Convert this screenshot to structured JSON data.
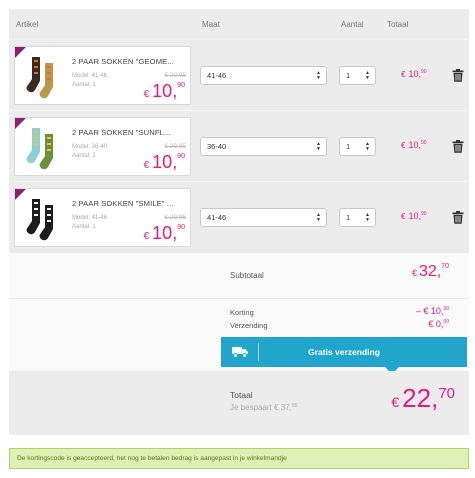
{
  "headers": {
    "article": "Artikel",
    "size": "Maat",
    "qty": "Aantal",
    "total": "Totaal"
  },
  "items": [
    {
      "name": "2 PAAR SOKKEN \"GEOME...",
      "model": "Model: 41-46",
      "qty_label": "Aantal: 1",
      "old_price": "€ 29,95",
      "price_euros": "10,",
      "price_cents": "90",
      "size": "41-46",
      "qty": "1",
      "row_total": "10,",
      "row_cents": "90",
      "colors": [
        "#3a2a22",
        "#e56a2c",
        "#b99a4d"
      ]
    },
    {
      "name": "2 PAAR SOKKEN \"SUNFL...",
      "model": "Model: 36-40",
      "qty_label": "Aantal: 1",
      "old_price": "€ 29,95",
      "price_euros": "10,",
      "price_cents": "90",
      "size": "36-40",
      "qty": "1",
      "row_total": "10,",
      "row_cents": "90",
      "colors": [
        "#8ccfd6",
        "#f2c531",
        "#6b8f3b"
      ]
    },
    {
      "name": "2 PAAR SOKKEN \"SMILE\" ...",
      "model": "Model: 41-46",
      "qty_label": "Aantal: 1",
      "old_price": "€ 29,95",
      "price_euros": "10,",
      "price_cents": "90",
      "size": "41-46",
      "qty": "1",
      "row_total": "10,",
      "row_cents": "90",
      "colors": [
        "#1c1c1c",
        "#f2f2f2",
        "#1c1c1c"
      ]
    }
  ],
  "currency": "€",
  "summary": {
    "subtotal_label": "Subtotaal",
    "subtotal_euros": "32,",
    "subtotal_cents": "70",
    "discount_label": "Korting",
    "discount_value": "– € 10,",
    "discount_cents": "00",
    "shipping_label": "Verzending",
    "shipping_value": "€ 0,",
    "shipping_cents": "00",
    "free_shipping": "Gratis verzending",
    "total_label": "Totaal",
    "saved_label": "Je bespaart € 37,",
    "saved_cents": "50",
    "total_euros": "22,",
    "total_cents": "70"
  },
  "alert": "De kortingscode is geaccepteerd, het nog te betalen bedrag is aangepast in je winkelmandje",
  "accent_color": "#e21a84",
  "shipping_color": "#22a5cb"
}
